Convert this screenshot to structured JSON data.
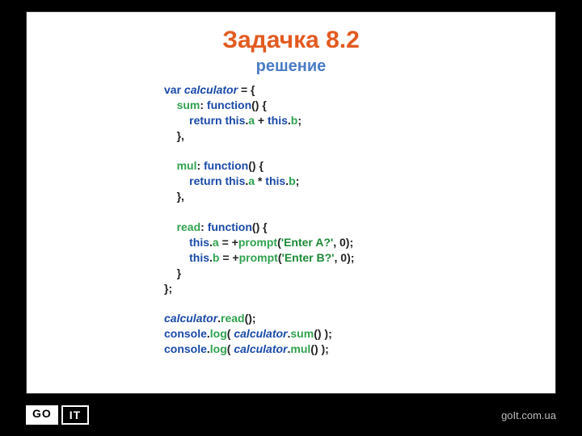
{
  "title": "Задачка 8.2",
  "subtitle": "решение",
  "code": {
    "l1": {
      "kw": "var",
      "id": " calculator",
      "rest": " = {"
    },
    "l2": {
      "indent": "    ",
      "prop": "sum",
      "rest": ": ",
      "kw": "function",
      "tail": "() {"
    },
    "l3": {
      "indent": "        ",
      "kw": "return this",
      "punc": ".",
      "mem1": "a",
      "mid": " + ",
      "kw2": "this",
      "punc2": ".",
      "mem2": "b",
      "tail": ";"
    },
    "l4": {
      "indent": "    ",
      "text": "},"
    },
    "l5": {
      "text": ""
    },
    "l6": {
      "indent": "    ",
      "prop": "mul",
      "rest": ": ",
      "kw": "function",
      "tail": "() {"
    },
    "l7": {
      "indent": "        ",
      "kw": "return this",
      "punc": ".",
      "mem1": "a",
      "mid": " * ",
      "kw2": "this",
      "punc2": ".",
      "mem2": "b",
      "tail": ";"
    },
    "l8": {
      "indent": "    ",
      "text": "},"
    },
    "l9": {
      "text": ""
    },
    "l10": {
      "indent": "    ",
      "prop": "read",
      "rest": ": ",
      "kw": "function",
      "tail": "() {"
    },
    "l11": {
      "indent": "        ",
      "kw": "this",
      "punc": ".",
      "mem": "a",
      "mid": " = +",
      "call": "prompt",
      "open": "(",
      "str": "'Enter A?'",
      "comma": ", 0);"
    },
    "l12": {
      "indent": "        ",
      "kw": "this",
      "punc": ".",
      "mem": "b",
      "mid": " = +",
      "call": "prompt",
      "open": "(",
      "str": "'Enter B?'",
      "comma": ", 0);"
    },
    "l13": {
      "indent": "    ",
      "text": "}"
    },
    "l14": {
      "text": "};"
    },
    "l15": {
      "text": ""
    },
    "l16": {
      "id": "calculator",
      "punc": ".",
      "call": "read",
      "tail": "();"
    },
    "l17": {
      "id": "console",
      "punc": ".",
      "call": "log",
      "open": "( ",
      "id2": "calculator",
      "punc2": ".",
      "call2": "sum",
      "tail": "() );"
    },
    "l18": {
      "id": "console",
      "punc": ".",
      "call": "log",
      "open": "( ",
      "id2": "calculator",
      "punc2": ".",
      "call2": "mul",
      "tail": "() );"
    }
  },
  "footer": {
    "logo_go": "GO",
    "logo_it": "IT",
    "site": "goIt.com.ua"
  }
}
